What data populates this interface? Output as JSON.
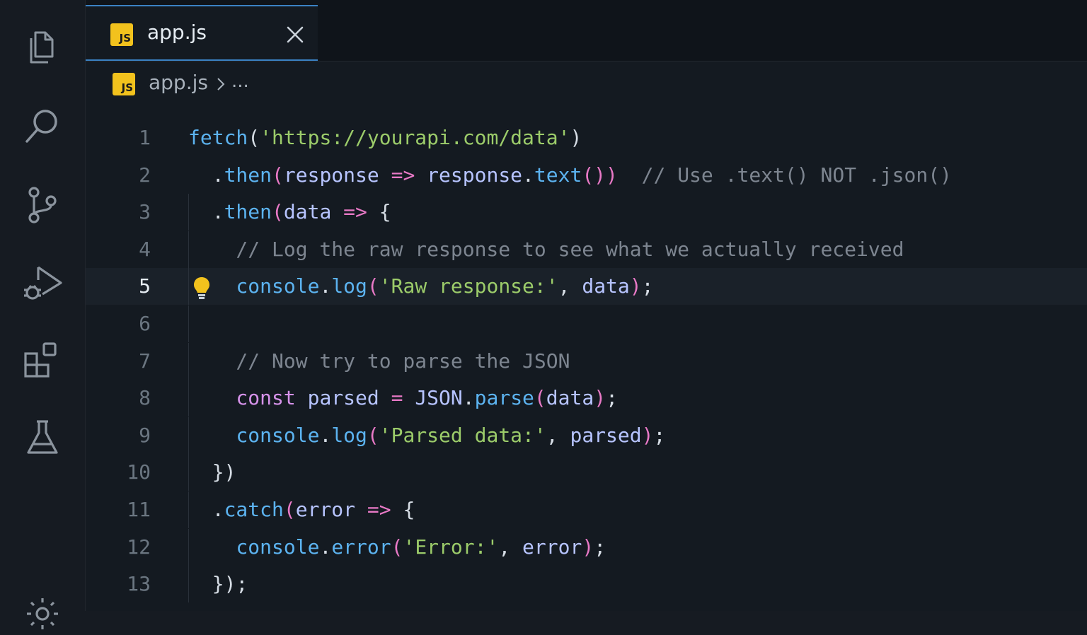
{
  "tab": {
    "label": "app.js",
    "badge": "JS"
  },
  "breadcrumb": {
    "file": "app.js",
    "badge": "JS",
    "more": "..."
  },
  "activity_bar": {
    "icons": [
      "explorer-icon",
      "search-icon",
      "source-control-icon",
      "run-debug-icon",
      "extensions-icon",
      "testing-icon",
      "settings-gear-icon"
    ]
  },
  "editor": {
    "current_line": 5,
    "lines": [
      {
        "num": "1",
        "tokens": [
          [
            "fetch",
            "t-fn"
          ],
          [
            "(",
            "t-punc"
          ],
          [
            "'https://yourapi.com/data'",
            "t-str"
          ],
          [
            ")",
            "t-punc"
          ]
        ]
      },
      {
        "num": "2",
        "tokens": [
          [
            "  .",
            "t-punc"
          ],
          [
            "then",
            "t-fn"
          ],
          [
            "(",
            "t-br"
          ],
          [
            "response",
            "t-var"
          ],
          [
            " ",
            "t-punc"
          ],
          [
            "=>",
            "t-op"
          ],
          [
            " ",
            "t-punc"
          ],
          [
            "response",
            "t-var"
          ],
          [
            ".",
            "t-punc"
          ],
          [
            "text",
            "t-fn"
          ],
          [
            "())",
            "t-br"
          ],
          [
            "  // Use .text() NOT .json()",
            "t-cm"
          ]
        ]
      },
      {
        "num": "3",
        "tokens": [
          [
            "  .",
            "t-punc"
          ],
          [
            "then",
            "t-fn"
          ],
          [
            "(",
            "t-br"
          ],
          [
            "data",
            "t-var"
          ],
          [
            " ",
            "t-punc"
          ],
          [
            "=>",
            "t-op"
          ],
          [
            " {",
            "t-punc"
          ]
        ]
      },
      {
        "num": "4",
        "tokens": [
          [
            "    // Log the raw response to see what we actually received",
            "t-cm"
          ]
        ]
      },
      {
        "num": "5",
        "tokens": [
          [
            "    ",
            "t-punc"
          ],
          [
            "console",
            "t-fn"
          ],
          [
            ".",
            "t-punc"
          ],
          [
            "log",
            "t-fn"
          ],
          [
            "(",
            "t-br"
          ],
          [
            "'Raw response:'",
            "t-str"
          ],
          [
            ", ",
            "t-punc"
          ],
          [
            "data",
            "t-var"
          ],
          [
            ")",
            "t-br"
          ],
          [
            ";",
            "t-punc"
          ]
        ]
      },
      {
        "num": "6",
        "tokens": []
      },
      {
        "num": "7",
        "tokens": [
          [
            "    // Now try to parse the JSON",
            "t-cm"
          ]
        ]
      },
      {
        "num": "8",
        "tokens": [
          [
            "    ",
            "t-punc"
          ],
          [
            "const",
            "t-kw"
          ],
          [
            " ",
            "t-punc"
          ],
          [
            "parsed",
            "t-var"
          ],
          [
            " = ",
            "t-op"
          ],
          [
            "JSON",
            "t-var"
          ],
          [
            ".",
            "t-punc"
          ],
          [
            "parse",
            "t-fn"
          ],
          [
            "(",
            "t-br"
          ],
          [
            "data",
            "t-var"
          ],
          [
            ")",
            "t-br"
          ],
          [
            ";",
            "t-punc"
          ]
        ]
      },
      {
        "num": "9",
        "tokens": [
          [
            "    ",
            "t-punc"
          ],
          [
            "console",
            "t-fn"
          ],
          [
            ".",
            "t-punc"
          ],
          [
            "log",
            "t-fn"
          ],
          [
            "(",
            "t-br"
          ],
          [
            "'Parsed data:'",
            "t-str"
          ],
          [
            ", ",
            "t-punc"
          ],
          [
            "parsed",
            "t-var"
          ],
          [
            ")",
            "t-br"
          ],
          [
            ";",
            "t-punc"
          ]
        ]
      },
      {
        "num": "10",
        "tokens": [
          [
            "  })",
            "t-punc"
          ]
        ]
      },
      {
        "num": "11",
        "tokens": [
          [
            "  .",
            "t-punc"
          ],
          [
            "catch",
            "t-fn"
          ],
          [
            "(",
            "t-br"
          ],
          [
            "error",
            "t-var"
          ],
          [
            " ",
            "t-punc"
          ],
          [
            "=>",
            "t-op"
          ],
          [
            " {",
            "t-punc"
          ]
        ]
      },
      {
        "num": "12",
        "tokens": [
          [
            "    ",
            "t-punc"
          ],
          [
            "console",
            "t-fn"
          ],
          [
            ".",
            "t-punc"
          ],
          [
            "error",
            "t-fn"
          ],
          [
            "(",
            "t-br"
          ],
          [
            "'Error:'",
            "t-str"
          ],
          [
            ", ",
            "t-punc"
          ],
          [
            "error",
            "t-var"
          ],
          [
            ")",
            "t-br"
          ],
          [
            ";",
            "t-punc"
          ]
        ]
      },
      {
        "num": "13",
        "tokens": [
          [
            "  });",
            "t-punc"
          ]
        ]
      }
    ]
  },
  "colors": {
    "background": "#141a21",
    "accent": "#3b82c4",
    "js_badge": "#f2c21d",
    "lightbulb": "#f2c21d"
  }
}
